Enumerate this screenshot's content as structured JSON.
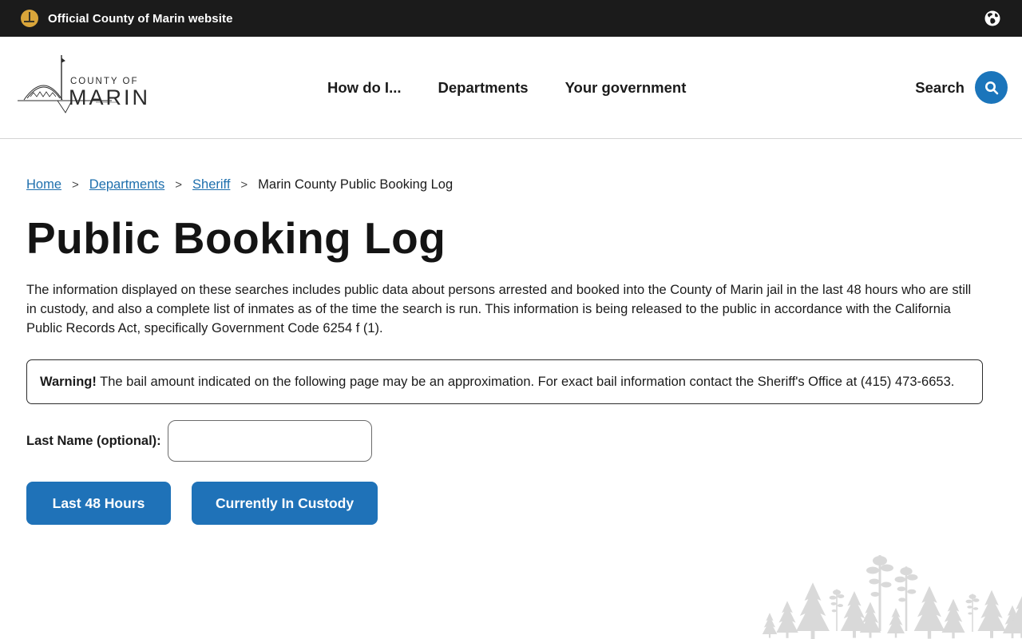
{
  "topbar": {
    "official_text": "Official County of Marin website"
  },
  "header": {
    "logo": {
      "line1": "COUNTY OF",
      "line2": "MARIN"
    },
    "nav": [
      {
        "label": "How do I..."
      },
      {
        "label": "Departments"
      },
      {
        "label": "Your government"
      }
    ],
    "search_label": "Search"
  },
  "breadcrumb": {
    "separator": ">",
    "items": [
      {
        "label": "Home"
      },
      {
        "label": "Departments"
      },
      {
        "label": "Sheriff"
      },
      {
        "label": "Marin County Public Booking Log"
      }
    ]
  },
  "main": {
    "title": "Public Booking Log",
    "intro": "The information displayed on these searches includes public data about persons arrested and booked into the County of Marin jail in the last 48 hours who are still in custody, and also a complete list of inmates as of the time the search is run. This information is being released to the public in accordance with the California Public Records Act, specifically Government Code 6254 f (1).",
    "warning": {
      "label": "Warning!",
      "text": " The bail amount indicated on the following page may be an approximation. For exact bail information contact the Sheriff's Office at (415) 473-6653."
    },
    "form": {
      "last_name_label": "Last Name (optional):",
      "last_name_value": "",
      "buttons": [
        {
          "label": "Last 48 Hours"
        },
        {
          "label": "Currently In Custody"
        }
      ]
    }
  },
  "icons": {
    "badge": "gold-civic-center-badge",
    "globe": "language-globe",
    "search": "magnifier"
  },
  "colors": {
    "topbar_bg": "#1b1b1b",
    "accent_blue": "#1b75bb",
    "button_blue": "#1f72b8",
    "link_blue": "#1e6fad",
    "gold": "#d9a53a",
    "tree_gray": "#d9d9d9"
  }
}
